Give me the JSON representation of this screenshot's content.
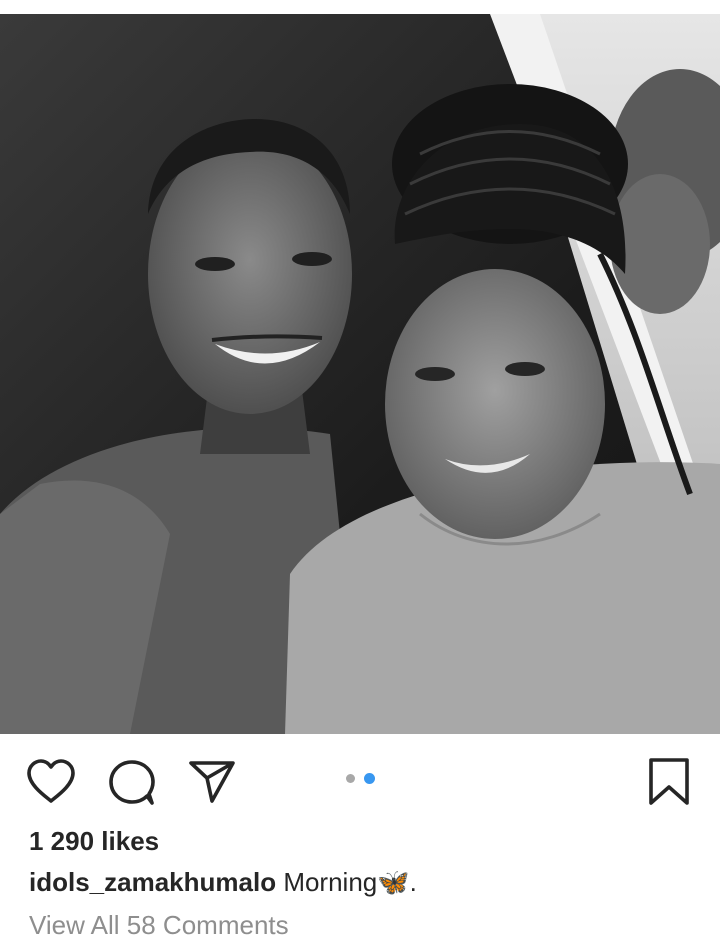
{
  "post": {
    "likes_text": "1 290 likes",
    "username": "idols_zamakhumalo",
    "caption_text": "Morning",
    "caption_emoji": "🦋",
    "caption_suffix": ".",
    "view_comments_text": "View All 58 Comments"
  },
  "carousel": {
    "total_slides": 2,
    "active_slide": 2,
    "active_color": "#3897f0",
    "inactive_color": "#a8a8a8"
  },
  "icons": {
    "like": "heart-outline-icon",
    "comment": "speech-bubble-icon",
    "share": "paper-plane-icon",
    "save": "bookmark-outline-icon"
  }
}
